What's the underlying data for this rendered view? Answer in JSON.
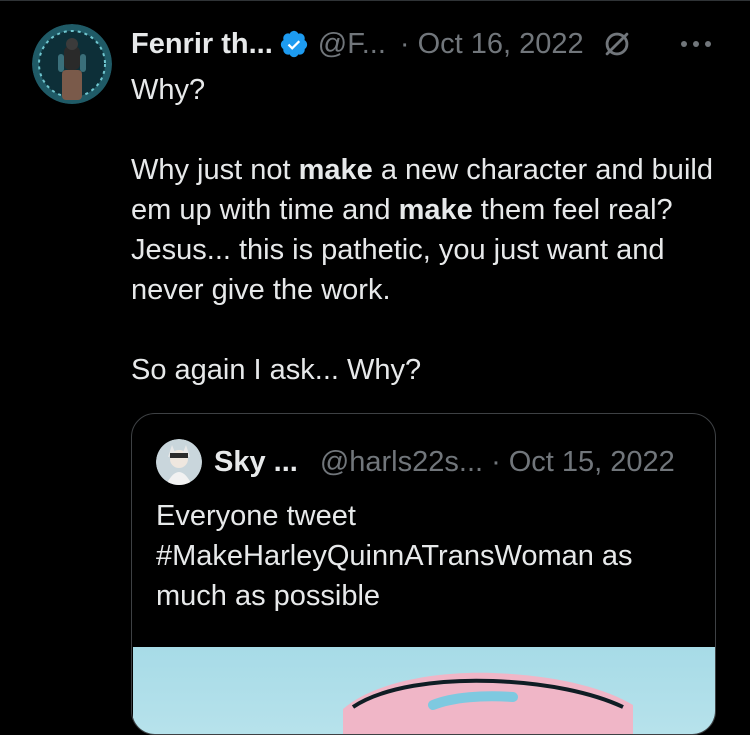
{
  "tweet": {
    "author_name": "Fenrir th...",
    "handle": "@F...",
    "separator": "·",
    "date": "Oct 16, 2022",
    "paragraphs": {
      "p1": "Why?",
      "p2_a": "Why just not ",
      "p2_b": "make",
      "p2_c": " a new character and build em up with time and ",
      "p2_d": "make",
      "p2_e": " them feel real? Jesus... this is pathetic, you just want and never give the work.",
      "p3": "So again I ask... Why?"
    },
    "icons": {
      "verified": "verified-badge-icon",
      "edited": "edited-icon",
      "more": "more-options-icon"
    }
  },
  "quoted_tweet": {
    "author_name": "Sky ...",
    "handle": "@harls22s...",
    "separator": "·",
    "date": "Oct 15, 2022",
    "text": "Everyone tweet #MakeHarleyQuinnATransWoman as much as possible"
  },
  "colors": {
    "background": "#000000",
    "text_primary": "#e7e9ea",
    "text_secondary": "#71767b",
    "verified_blue": "#1d9bf0",
    "card_border": "#3e4144"
  }
}
